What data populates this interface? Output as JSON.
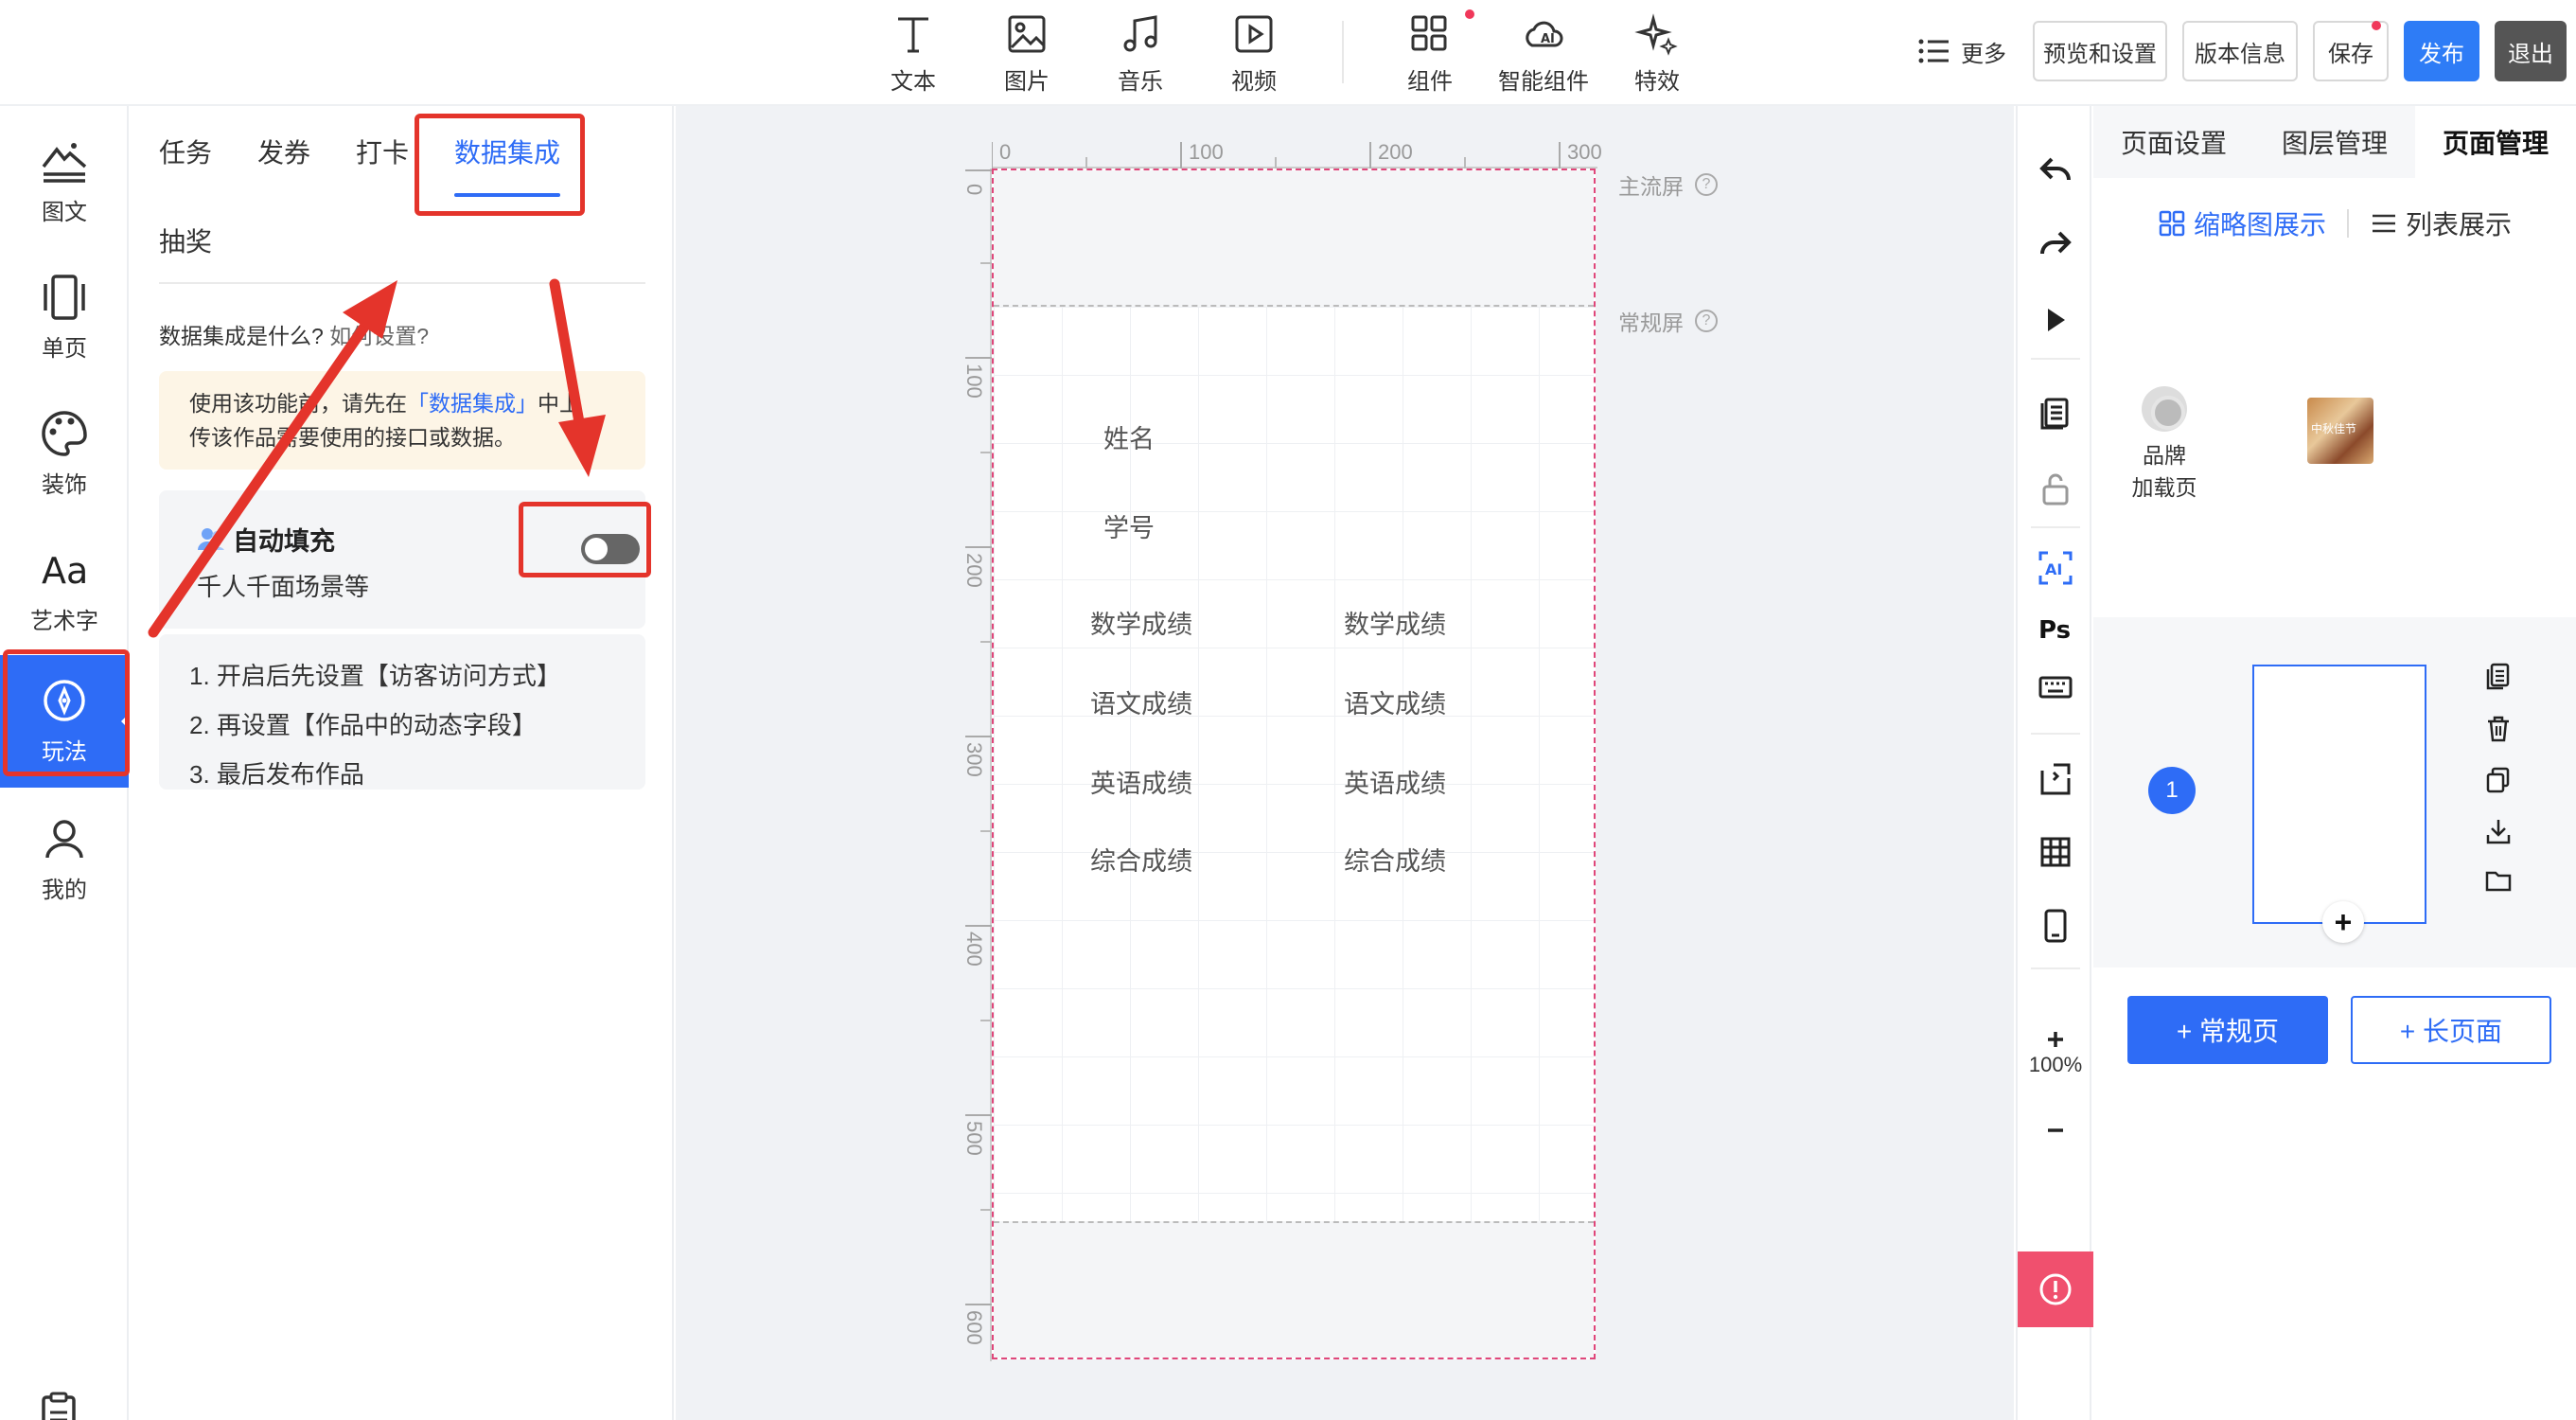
{
  "toolbar": {
    "tools": [
      {
        "label": "文本",
        "icon": "text-icon"
      },
      {
        "label": "图片",
        "icon": "image-icon"
      },
      {
        "label": "音乐",
        "icon": "music-icon"
      },
      {
        "label": "视频",
        "icon": "video-icon"
      },
      {
        "label": "组件",
        "icon": "component-icon"
      },
      {
        "label": "智能组件",
        "icon": "ai-cloud-icon"
      },
      {
        "label": "特效",
        "icon": "sparkle-icon"
      }
    ],
    "more_label": "更多",
    "preview_label": "预览和设置",
    "version_label": "版本信息",
    "save_label": "保存",
    "publish_label": "发布",
    "exit_label": "退出"
  },
  "leftnav": {
    "items": [
      {
        "label": "图文",
        "icon": "mountain-text-icon"
      },
      {
        "label": "单页",
        "icon": "single-page-icon"
      },
      {
        "label": "装饰",
        "icon": "palette-icon"
      },
      {
        "label": "艺术字",
        "icon": "art-text-icon",
        "glyph": "Aa"
      },
      {
        "label": "玩法",
        "icon": "compass-icon",
        "active": true
      },
      {
        "label": "我的",
        "icon": "user-icon"
      }
    ]
  },
  "leftpanel": {
    "tabs": [
      {
        "label": "任务"
      },
      {
        "label": "发券"
      },
      {
        "label": "打卡"
      },
      {
        "label": "数据集成",
        "active": true
      }
    ],
    "subtab": "抽奖",
    "help_question": "数据集成是什么?",
    "help_link": "如何设置?",
    "notice_line1_pre": "使用该功能前，请先在",
    "notice_link": "「数据集成」",
    "notice_line1_post": "中上",
    "notice_line2": "传该作品需要使用的接口或数据。",
    "autofill_title": "自动填充",
    "autofill_desc": "千人千面场景等",
    "autofill_enabled": false,
    "steps": [
      "1. 开启后先设置【访客访问方式】",
      "2. 再设置【作品中的动态字段】",
      "3. 最后发布作品"
    ]
  },
  "canvas": {
    "ruler_top": [
      "0",
      "100",
      "200",
      "300"
    ],
    "ruler_left": [
      "0",
      "100",
      "200",
      "300",
      "400",
      "500",
      "600"
    ],
    "main_screen_label": "主流屏",
    "normal_screen_label": "常规屏",
    "fields": {
      "name": "姓名",
      "student_id": "学号",
      "math_left": "数学成绩",
      "math_right": "数学成绩",
      "chinese_left": "语文成绩",
      "chinese_right": "语文成绩",
      "english_left": "英语成绩",
      "english_right": "英语成绩",
      "total_left": "综合成绩",
      "total_right": "综合成绩"
    }
  },
  "righttools": {
    "ps_label": "Ps",
    "ai_label": "AI",
    "zoom": "100%"
  },
  "rightpanel": {
    "tabs": [
      {
        "label": "页面设置"
      },
      {
        "label": "图层管理"
      },
      {
        "label": "页面管理",
        "active": true
      }
    ],
    "view_thumb": "缩略图展示",
    "view_list": "列表展示",
    "brand_line1": "品牌",
    "brand_line2": "加载页",
    "thumb_text": "中秋佳节",
    "page_number": "1",
    "add_normal": "+ 常规页",
    "add_long": "+ 长页面"
  },
  "colors": {
    "accent": "#2e6cf6",
    "annotation": "#e4342b",
    "alert": "#f0506e"
  }
}
